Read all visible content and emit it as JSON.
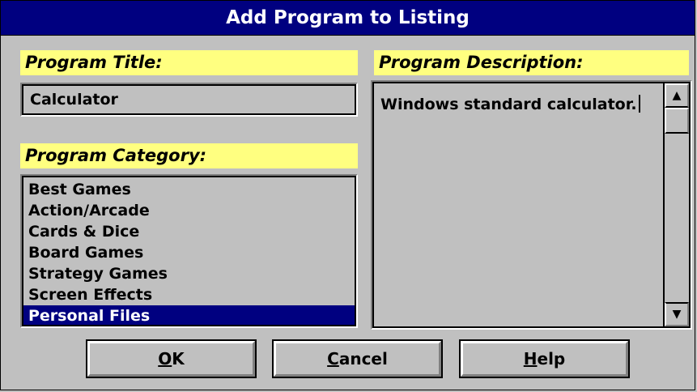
{
  "dialog": {
    "title": "Add Program to Listing"
  },
  "program_title": {
    "label": "Program Title:",
    "value": "Calculator"
  },
  "program_category": {
    "label": "Program Category:",
    "items": [
      {
        "label": "Best Games",
        "selected": false
      },
      {
        "label": "Action/Arcade",
        "selected": false
      },
      {
        "label": "Cards & Dice",
        "selected": false
      },
      {
        "label": "Board Games",
        "selected": false
      },
      {
        "label": "Strategy Games",
        "selected": false
      },
      {
        "label": "Screen Effects",
        "selected": false
      },
      {
        "label": "Personal Files",
        "selected": true
      }
    ]
  },
  "program_description": {
    "label": "Program Description:",
    "value": "Windows standard calculator.",
    "scroll_up_icon": "arrow-up-icon",
    "scroll_down_icon": "arrow-down-icon"
  },
  "buttons": {
    "ok": {
      "mnemonic": "O",
      "rest": "K"
    },
    "cancel": {
      "mnemonic": "C",
      "rest": "ancel"
    },
    "help": {
      "mnemonic": "H",
      "rest": "elp"
    }
  },
  "colors": {
    "title_bar": "#000080",
    "label_background": "#ffff80",
    "selection": "#000080",
    "dialog_face": "#c0c0c0"
  }
}
